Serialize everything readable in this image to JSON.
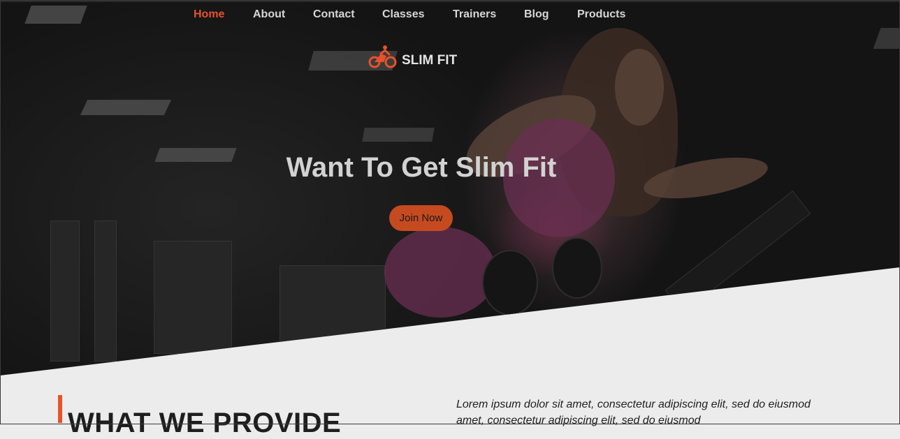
{
  "nav": {
    "items": [
      {
        "label": "Home",
        "active": true
      },
      {
        "label": "About",
        "active": false
      },
      {
        "label": "Contact",
        "active": false
      },
      {
        "label": "Classes",
        "active": false
      },
      {
        "label": "Trainers",
        "active": false
      },
      {
        "label": "Blog",
        "active": false
      },
      {
        "label": "Products",
        "active": false
      }
    ]
  },
  "logo": {
    "text": "SLIM FIT",
    "icon": "cyclist-icon"
  },
  "hero": {
    "title": "Want To Get Slim Fit",
    "cta_label": "Join Now"
  },
  "section": {
    "title": "WHAT WE PROVIDE",
    "text": "Lorem ipsum dolor sit amet, consectetur adipiscing elit, sed do eiusmod amet, consectetur adipiscing elit, sed do eiusmod"
  },
  "colors": {
    "accent": "#e8522a",
    "button": "#c64a20",
    "hero_text": "#d2d2d2",
    "page_background": "#ececec"
  }
}
